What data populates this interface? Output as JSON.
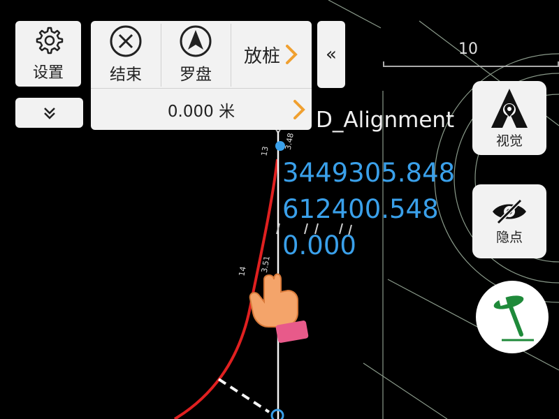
{
  "toolbar": {
    "settings_label": "设置",
    "end_label": "结束",
    "compass_label": "罗盘",
    "stake_label": "放桩",
    "distance_value": "0.000 米",
    "collapse_label": "«"
  },
  "side_buttons": {
    "view_label": "视觉",
    "hide_points_label": "隐点"
  },
  "map": {
    "scale_label": "10",
    "alignment_name": "D_Alignment",
    "northing": "3449305.848",
    "easting": "612400.548",
    "elevation": "0.000",
    "station_labels": [
      "13",
      "3.48",
      "14",
      "3.51"
    ]
  },
  "icons": {
    "settings": "gear-icon",
    "expand": "chevron-double-down-icon",
    "end": "circle-x-icon",
    "compass": "compass-arrow-icon",
    "stake_next": "chevron-right-icon",
    "distance_next": "chevron-right-icon",
    "view": "location-a-icon",
    "hide": "eye-slash-icon",
    "stake_pin": "survey-pin-icon",
    "hand": "hand-pointer-icon"
  },
  "colors": {
    "accent_orange": "#f0a030",
    "coordinate_blue": "#3aa0ea",
    "curve_red": "#e02020",
    "pin_green": "#1f8a3a"
  }
}
